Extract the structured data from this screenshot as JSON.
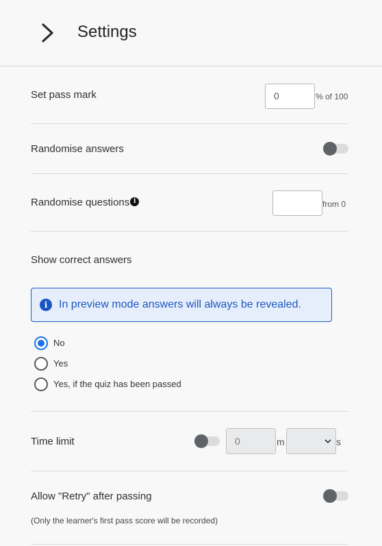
{
  "header": {
    "title": "Settings",
    "back_icon": "chevron-right-icon"
  },
  "pass_mark": {
    "label": "Set pass mark",
    "value": "0",
    "suffix": "% of 100"
  },
  "randomise_answers": {
    "label": "Randomise answers",
    "enabled": false
  },
  "randomise_questions": {
    "label": "Randomise questions",
    "info_icon": "i",
    "value": "",
    "suffix": "from 0"
  },
  "show_correct_answers": {
    "label": "Show correct answers",
    "info_icon": "i",
    "info_message": "In preview mode answers will always be revealed.",
    "options": [
      {
        "label": "No",
        "selected": true
      },
      {
        "label": "Yes",
        "selected": false
      },
      {
        "label": "Yes, if the quiz has been passed",
        "selected": false
      }
    ]
  },
  "time_limit": {
    "label": "Time limit",
    "enabled": false,
    "minutes_value": "0",
    "minutes_suffix": "m",
    "seconds_value": "",
    "seconds_suffix": "s"
  },
  "allow_retry": {
    "label": "Allow \"Retry\" after passing",
    "enabled": false,
    "note": "(Only the learner's first pass score will be recorded)"
  }
}
